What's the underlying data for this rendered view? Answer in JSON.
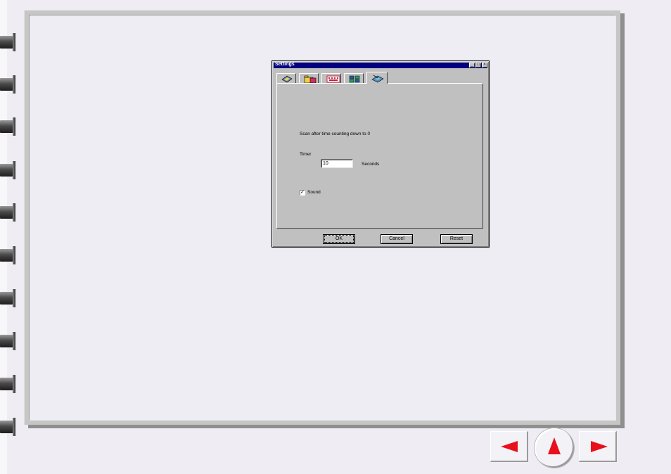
{
  "dialog": {
    "title": "Settings",
    "window_controls": [
      "_",
      "□",
      "×"
    ],
    "tabs": [
      {
        "name": "scanner-settings",
        "icon": "scanner-icon",
        "active": false
      },
      {
        "name": "folder-settings",
        "icon": "folder-icon",
        "active": false
      },
      {
        "name": "sound-settings",
        "icon": "keyboard-icon",
        "active": false
      },
      {
        "name": "color-settings",
        "icon": "grid-icon",
        "active": false
      },
      {
        "name": "timer-settings",
        "icon": "timer-scanner-icon",
        "active": true
      }
    ],
    "description": "Scan after time counting down to 0",
    "timer_label": "Timer",
    "timer_value": "10",
    "seconds_label": "Seconds",
    "sound_label": "Sound",
    "sound_checked": true,
    "buttons": {
      "ok": "OK",
      "cancel": "Cancel",
      "reset": "Reset"
    }
  },
  "navigation": {
    "prev_icon": "left-arrow-icon",
    "home_icon": "up-arrow-icon",
    "next_icon": "right-arrow-icon",
    "accent_color": "#e8101c"
  }
}
